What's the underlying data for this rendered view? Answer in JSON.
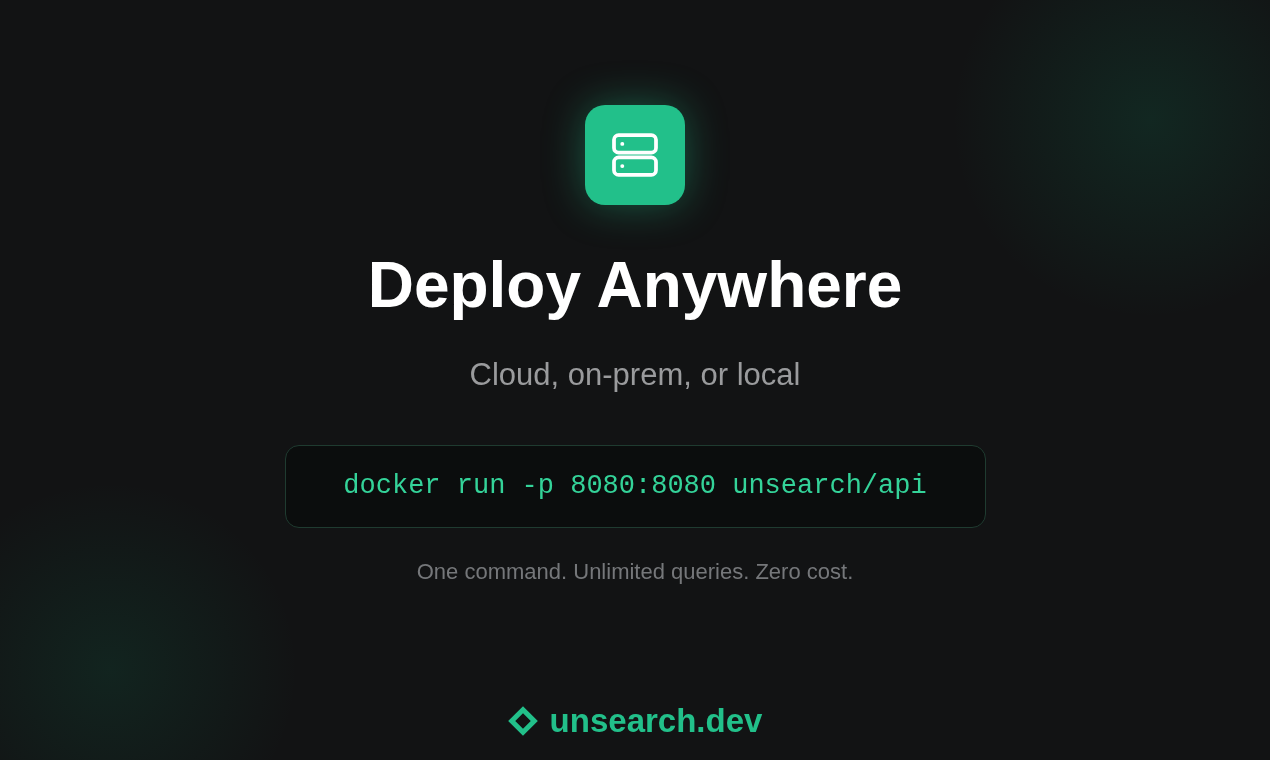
{
  "title": "Deploy Anywhere",
  "subtitle": "Cloud, on-prem, or local",
  "command": "docker run -p 8080:8080 unsearch/api",
  "tagline": "One command. Unlimited queries. Zero cost.",
  "brand": {
    "name": "unsearch.dev"
  }
}
